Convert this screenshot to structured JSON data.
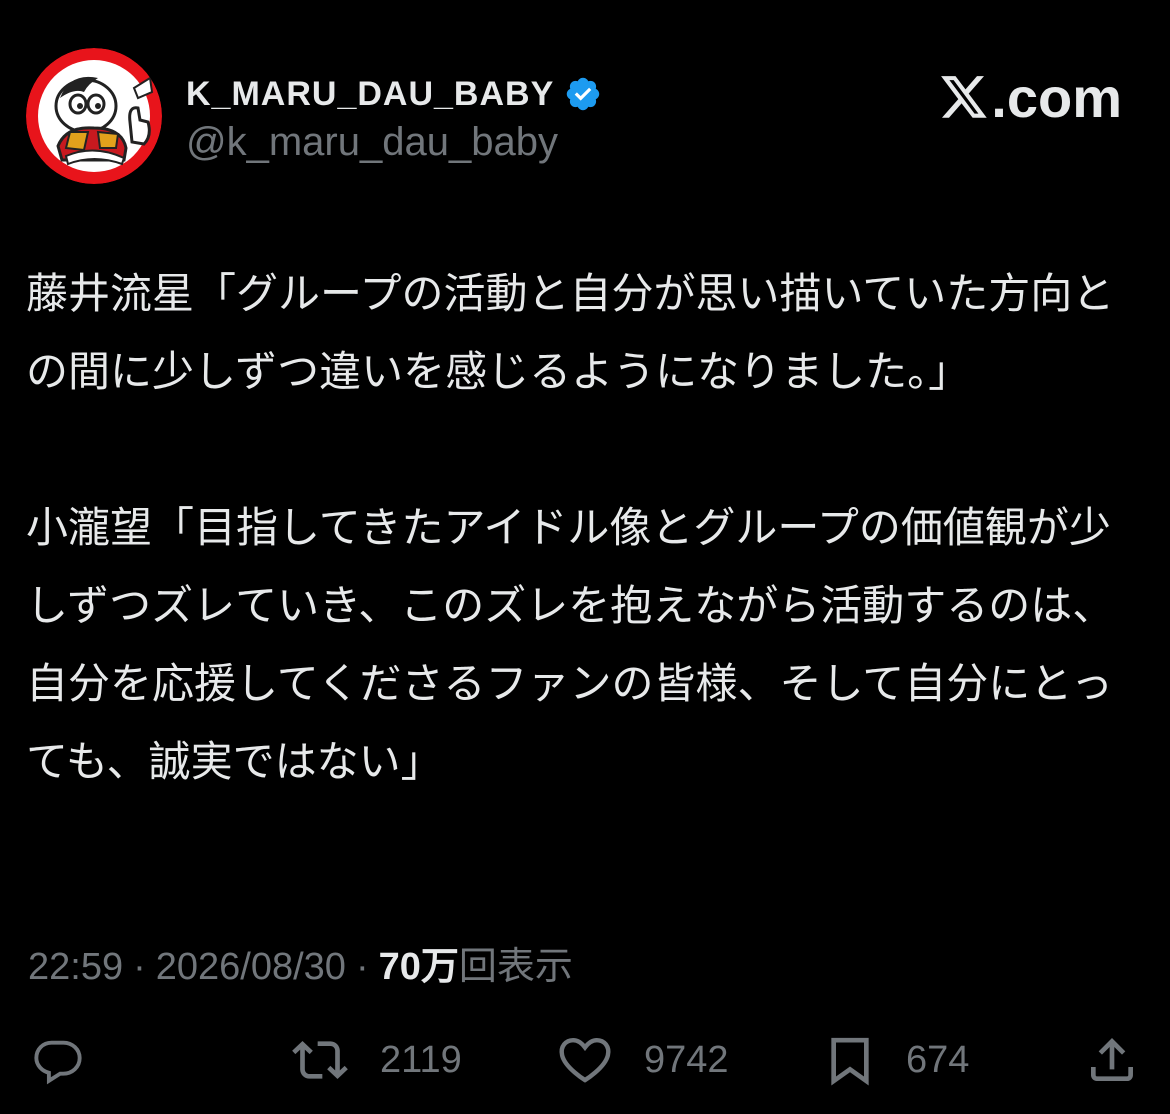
{
  "user": {
    "display_name": "K_MARU_DAU_BABY",
    "handle": "@k_maru_dau_baby",
    "verified": true,
    "avatar_icon": "cartoon-mascot-avatar"
  },
  "brand": {
    "text": ".com",
    "logo_icon": "x-logo-icon"
  },
  "tweet": {
    "paragraphs": [
      "藤井流星「グループの活動と自分が思い描いていた方向との間に少しずつ違いを感じるようになりました。」",
      "小瀧望「目指してきたアイドル像とグループの価値観が少しずつズレていき、このズレを抱えながら活動するのは、自分を応援してくださるファンの皆様、そして自分にとっても、誠実ではない」"
    ]
  },
  "meta": {
    "time": "22:59",
    "separator": "·",
    "date": "2026/08/30",
    "views_count": "70万",
    "views_label": "回表示"
  },
  "actions": {
    "reply": {
      "icon": "reply-icon",
      "count": ""
    },
    "retweet": {
      "icon": "retweet-icon",
      "count": "2119"
    },
    "like": {
      "icon": "heart-icon",
      "count": "9742"
    },
    "bookmark": {
      "icon": "bookmark-icon",
      "count": "674"
    },
    "share": {
      "icon": "share-icon"
    }
  },
  "colors": {
    "background": "#000000",
    "primary_text": "#e7e9ea",
    "secondary_text": "#71767b",
    "verified_badge": "#1d9bf0",
    "avatar_ring": "#e8141b"
  }
}
